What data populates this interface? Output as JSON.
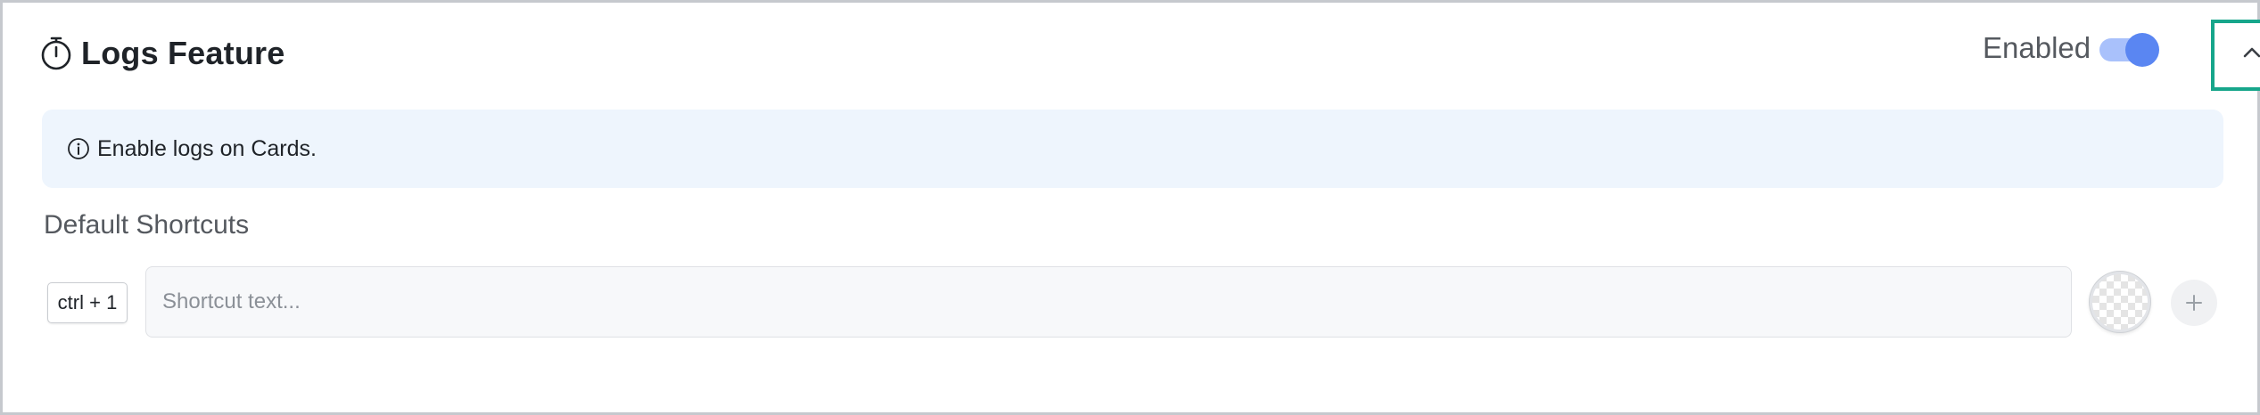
{
  "header": {
    "title": "Logs Feature",
    "title_icon": "stopwatch-icon",
    "enabled_label": "Enabled",
    "enabled": true,
    "collapse_icon": "chevron-up-icon"
  },
  "info": {
    "icon": "info-icon",
    "text": "Enable logs on Cards."
  },
  "shortcuts": {
    "section_title": "Default Shortcuts",
    "items": [
      {
        "key": "ctrl + 1",
        "value": "",
        "placeholder": "Shortcut text...",
        "color_icon": "transparent-color-swatch",
        "add_icon": "plus-icon"
      }
    ]
  },
  "colors": {
    "toggle_knob": "#5a86f2",
    "toggle_track": "#a9c1fb",
    "focus_outline": "#17a68b",
    "info_background": "#eef5fd"
  }
}
